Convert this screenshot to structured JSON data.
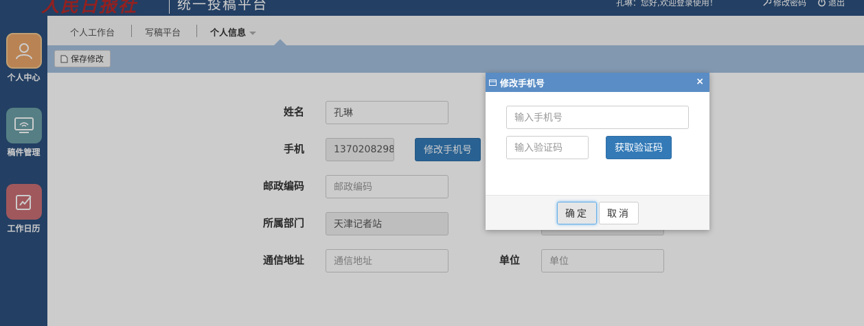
{
  "header": {
    "logo_text": "人民日报社",
    "platform_title": "统一投稿平台",
    "welcome": "孔琳：您好,欢迎登录使用！",
    "change_password": "修改密码",
    "logout": "退出"
  },
  "sidebar": {
    "items": [
      {
        "label": "个人中心",
        "icon": "user-icon",
        "color": "#e8a46a"
      },
      {
        "label": "稿件管理",
        "icon": "monitor-icon",
        "color": "#6b9fa6"
      },
      {
        "label": "工作日历",
        "icon": "calendar-edit-icon",
        "color": "#c96e74"
      }
    ]
  },
  "nav": {
    "tabs": [
      {
        "label": "个人工作台"
      },
      {
        "label": "写稿平台"
      },
      {
        "label": "个人信息"
      }
    ]
  },
  "toolbar": {
    "save_label": "保存修改"
  },
  "form": {
    "name_label": "姓名",
    "name_value": "孔琳",
    "phone_label": "手机",
    "phone_value": "1370208298",
    "change_phone_button": "修改手机号",
    "postcode_label": "邮政编码",
    "postcode_placeholder": "邮政编码",
    "dept_label": "所属部门",
    "dept_value": "天津记者站",
    "address_label": "通信地址",
    "address_placeholder": "通信地址",
    "unit_label": "单位",
    "unit_placeholder": "单位"
  },
  "dialog": {
    "title": "修改手机号",
    "close": "×",
    "phone_placeholder": "输入手机号",
    "code_placeholder": "输入验证码",
    "get_code_button": "获取验证码",
    "confirm_button": "确定",
    "cancel_button": "取消"
  },
  "colors": {
    "topbar": "#2c4f7c",
    "toolbar": "#a3bedc",
    "dialog_header": "#5a8dc5",
    "primary": "#337ab7"
  }
}
